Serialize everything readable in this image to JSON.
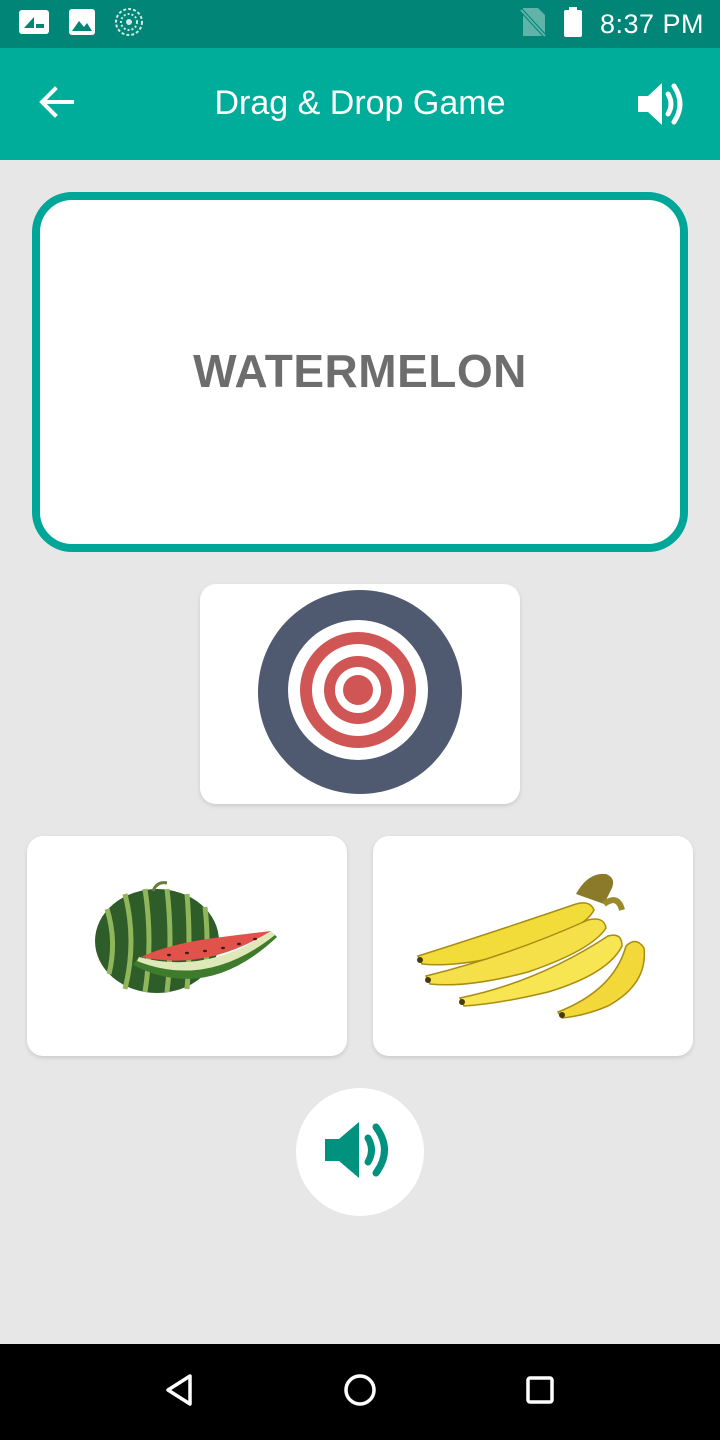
{
  "status_bar": {
    "time": "8:37 PM",
    "icons": [
      "notification-icon",
      "image-icon",
      "sync-icon",
      "no-sim-icon",
      "battery-icon"
    ]
  },
  "app_bar": {
    "title": "Drag & Drop Game",
    "back_icon": "arrow-left-icon",
    "sound_icon": "speaker-icon"
  },
  "word_card": {
    "word": "WATERMELON"
  },
  "target": {
    "icon": "target-icon"
  },
  "options": [
    {
      "icon": "watermelon-image"
    },
    {
      "icon": "banana-image"
    }
  ],
  "play_button": {
    "icon": "speaker-icon"
  },
  "nav_bar": {
    "icons": [
      "back-triangle-icon",
      "home-circle-icon",
      "recents-square-icon"
    ]
  },
  "colors": {
    "status_bar": "#008577",
    "app_bar": "#00ad9a",
    "word_border": "#00a799",
    "word_text": "#6d6d6d",
    "background": "#e6e7e6",
    "speaker_accent": "#00927f",
    "target_outer": "#4f5a70",
    "target_red": "#d05656"
  }
}
